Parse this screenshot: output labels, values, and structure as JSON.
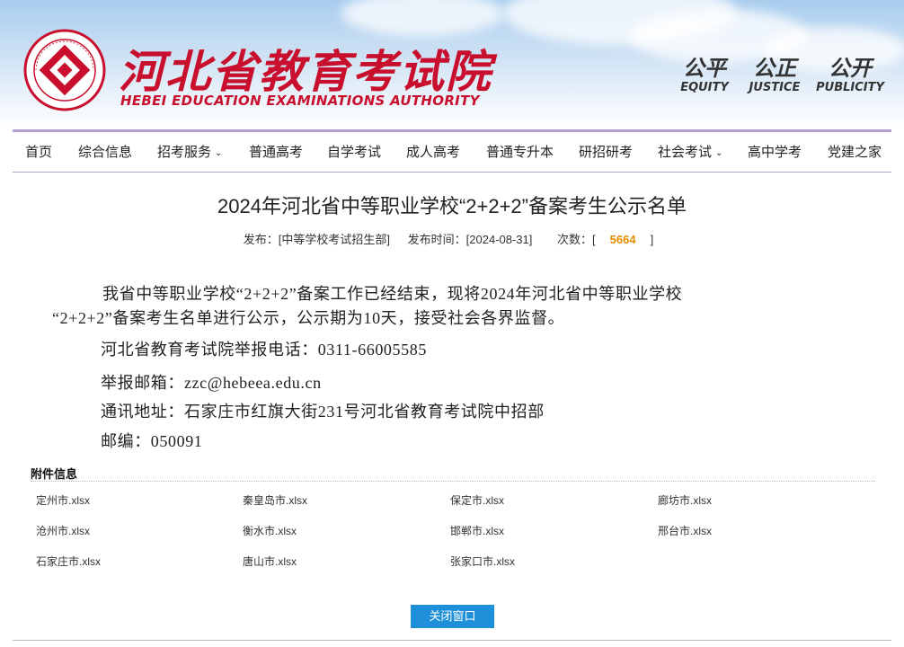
{
  "header": {
    "title_cn": "河北省教育考试院",
    "title_en": "HEBEI EDUCATION EXAMINATIONS AUTHORITY",
    "logo_icon": "hebei-exam-seal-icon",
    "brand_color": "#c8102e",
    "mottos": [
      {
        "cn": "公平",
        "en": "EQUITY"
      },
      {
        "cn": "公正",
        "en": "JUSTICE"
      },
      {
        "cn": "公开",
        "en": "PUBLICITY"
      }
    ]
  },
  "nav": {
    "items": [
      {
        "label": "首页",
        "dropdown": false
      },
      {
        "label": "综合信息",
        "dropdown": false
      },
      {
        "label": "招考服务",
        "dropdown": true
      },
      {
        "label": "普通高考",
        "dropdown": false
      },
      {
        "label": "自学考试",
        "dropdown": false
      },
      {
        "label": "成人高考",
        "dropdown": false
      },
      {
        "label": "普通专升本",
        "dropdown": false
      },
      {
        "label": "研招研考",
        "dropdown": false
      },
      {
        "label": "社会考试",
        "dropdown": true
      },
      {
        "label": "高中学考",
        "dropdown": false
      },
      {
        "label": "党建之家",
        "dropdown": false
      }
    ],
    "border_color": "#b4a0cf"
  },
  "article": {
    "title": "2024年河北省中等职业学校“2+2+2”备案考生公示名单",
    "publisher_label": "发布：[中等学校考试招生部]",
    "date_label": "发布时间：[2024-08-31]",
    "views_prefix": "次数：[",
    "views": "5664",
    "views_suffix": "]",
    "paragraph_line1": "我省中等职业学校“2+2+2”备案工作已经结束，现将2024年河北省中等职业学校",
    "paragraph_line2": "“2+2+2”备案考生名单进行公示，公示期为10天，接受社会各界监督。",
    "phone": "河北省教育考试院举报电话：0311-66005585",
    "email": "举报邮箱：zzc@hebeea.edu.cn",
    "address": "通讯地址：石家庄市红旗大街231号河北省教育考试院中招部",
    "postcode": "邮编：050091"
  },
  "attachments": {
    "title": "附件信息",
    "files": [
      "定州市.xlsx",
      "秦皇岛市.xlsx",
      "保定市.xlsx",
      "廊坊市.xlsx",
      "沧州市.xlsx",
      "衡水市.xlsx",
      "邯郸市.xlsx",
      "邢台市.xlsx",
      "石家庄市.xlsx",
      "唐山市.xlsx",
      "张家口市.xlsx"
    ]
  },
  "close_button": {
    "label": "关闭窗口",
    "color": "#1e90d9"
  }
}
